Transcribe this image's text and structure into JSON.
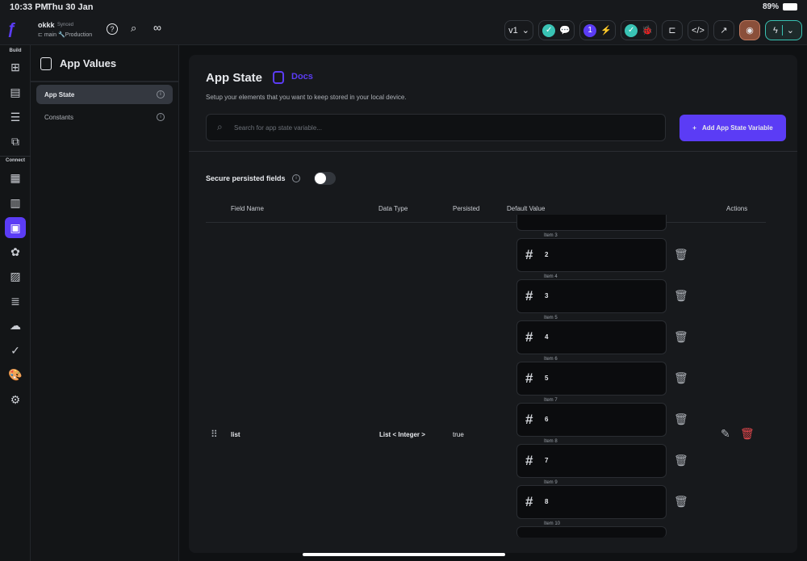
{
  "status": {
    "time": "10:33 PM",
    "date": "Thu 30 Jan",
    "battery": "89%"
  },
  "project": {
    "name": "okkk",
    "sync": "Synced",
    "branch": "main",
    "env": "Production"
  },
  "toolbar": {
    "version": "v1",
    "notif_count": "1"
  },
  "rail": {
    "build_label": "Build",
    "connect_label": "Connect"
  },
  "panel": {
    "title": "App Values",
    "items": [
      {
        "label": "App State"
      },
      {
        "label": "Constants"
      }
    ]
  },
  "main": {
    "title": "App State",
    "docs": "Docs",
    "description": "Setup your elements that you want to keep stored in your local device.",
    "search_placeholder": "Search for app state variable...",
    "add_button": "Add App State Variable",
    "secure_label": "Secure persisted fields",
    "columns": [
      "Field Name",
      "Data Type",
      "Persisted",
      "Default Value",
      "Actions"
    ],
    "row": {
      "field": "list",
      "type": "List < Integer >",
      "persisted": "true"
    },
    "items": [
      {
        "label": "Item 3",
        "value": "2"
      },
      {
        "label": "Item 4",
        "value": "3"
      },
      {
        "label": "Item 5",
        "value": "4"
      },
      {
        "label": "Item 6",
        "value": "5"
      },
      {
        "label": "Item 7",
        "value": "6"
      },
      {
        "label": "Item 8",
        "value": "7"
      },
      {
        "label": "Item 9",
        "value": "8"
      },
      {
        "label": "Item 10",
        "value": ""
      }
    ]
  },
  "colors": {
    "accent": "#5b3cf5",
    "teal": "#39c3b4",
    "danger": "#e5484d",
    "preview": "#8a4f3a"
  }
}
